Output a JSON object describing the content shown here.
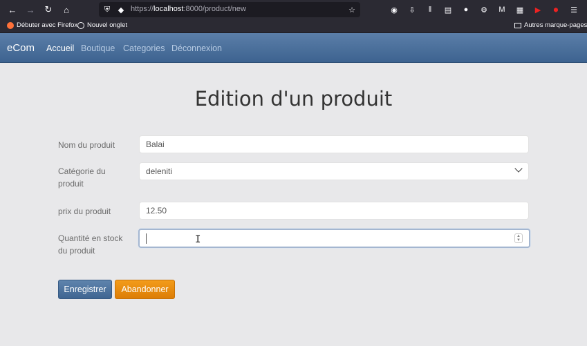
{
  "browser": {
    "url_prefix": "https://",
    "url_host": "localhost",
    "url_rest": ":8000/product/new",
    "bookmarks": [
      {
        "label": "Débuter avec Firefox"
      },
      {
        "label": "Nouvel onglet"
      }
    ],
    "other_bookmarks": "Autres marque-pages"
  },
  "navbar": {
    "brand": "eCom",
    "links": [
      "Accueil",
      "Boutique",
      "Categories",
      "Déconnexion"
    ]
  },
  "page": {
    "title": "Edition d'un produit"
  },
  "form": {
    "name_label": "Nom du produit",
    "name_value": "Balai",
    "category_label": "Catégorie du produit",
    "category_value": "deleniti",
    "price_label": "prix du produit",
    "price_value": "12.50",
    "stock_label": "Quantité en stock du produit",
    "stock_value": "",
    "save_label": "Enregistrer",
    "cancel_label": "Abandonner"
  }
}
